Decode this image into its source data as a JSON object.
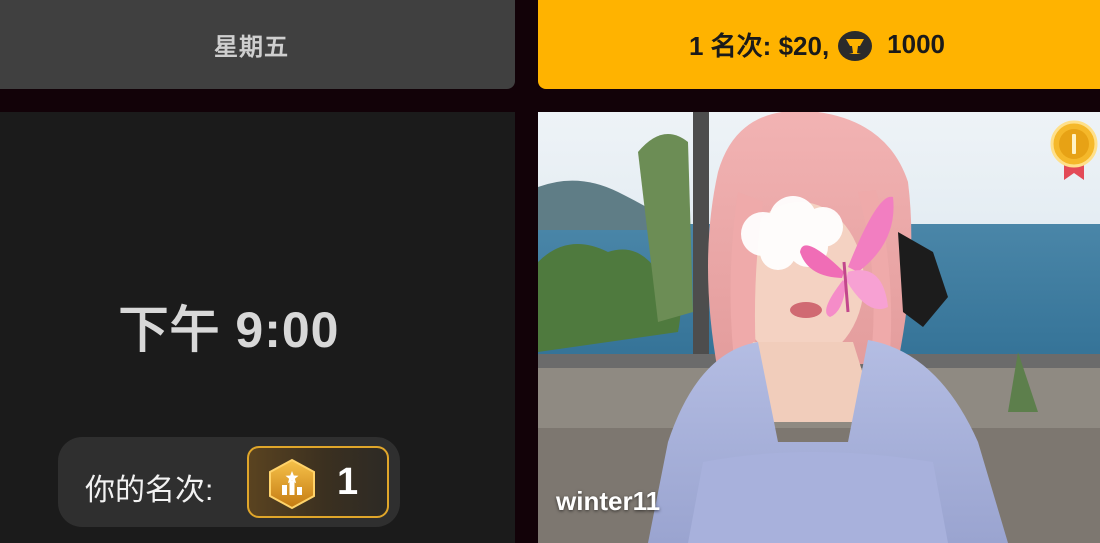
{
  "schedule": {
    "day_label": "星期五",
    "time_label": "下午 9:00"
  },
  "prize": {
    "text_main": "1 名次: $20,",
    "coin_icon": "coin-cup-icon",
    "coin_amount": "1000"
  },
  "my_rank": {
    "label": "你的名次:",
    "value": "1",
    "badge_icon": "rank-hexagon-icon"
  },
  "performer": {
    "username": "winter11",
    "medal_icon": "gold-medal-icon"
  },
  "colors": {
    "prize_bg": "#ffb300",
    "day_bg": "#404040",
    "panel_bg": "#1b1b1b",
    "page_bg": "#120208",
    "badge_border": "#e0a62a"
  }
}
